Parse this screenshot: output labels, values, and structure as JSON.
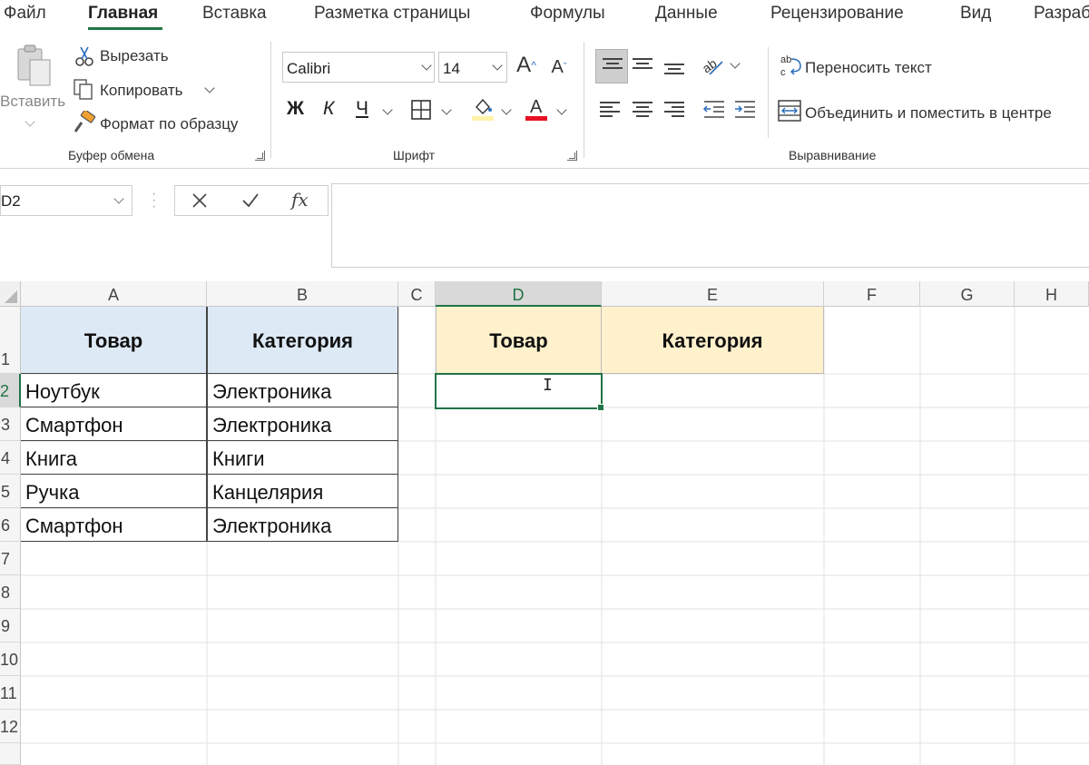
{
  "menu": {
    "tabs": [
      "Файл",
      "Главная",
      "Вставка",
      "Разметка страницы",
      "Формулы",
      "Данные",
      "Рецензирование",
      "Вид",
      "Разраб"
    ],
    "active_index": 1
  },
  "ribbon": {
    "clipboard": {
      "paste": "Вставить",
      "cut": "Вырезать",
      "copy": "Копировать",
      "format_painter": "Формат по образцу",
      "group_label": "Буфер обмена"
    },
    "font": {
      "font_name": "Calibri",
      "font_size": "14",
      "bold": "Ж",
      "italic": "К",
      "underline": "Ч",
      "group_label": "Шрифт",
      "fill_color": "#fff3a8",
      "font_color": "#e81123"
    },
    "alignment": {
      "wrap_text": "Переносить текст",
      "merge_center": "Объединить и поместить в центре",
      "group_label": "Выравнивание"
    }
  },
  "formula_bar": {
    "name_box": "D2",
    "fx": "fx",
    "content": ""
  },
  "grid": {
    "columns": [
      "A",
      "B",
      "C",
      "D",
      "E",
      "F",
      "G",
      "H"
    ],
    "selected_column": "D",
    "rows": [
      "1",
      "2",
      "3",
      "4",
      "5",
      "6",
      "7",
      "8",
      "9",
      "10",
      "11",
      "12"
    ],
    "selected_row": "2",
    "source_table": {
      "headers": [
        "Товар",
        "Категория"
      ],
      "rows": [
        [
          "Ноутбук",
          "Электроника"
        ],
        [
          "Смартфон",
          "Электроника"
        ],
        [
          "Книга",
          "Книги"
        ],
        [
          "Ручка",
          "Канцелярия"
        ],
        [
          "Смартфон",
          "Электроника"
        ]
      ]
    },
    "target_table": {
      "headers": [
        "Товар",
        "Категория"
      ]
    },
    "active_cell": "D2",
    "accent_color": "#217346"
  }
}
